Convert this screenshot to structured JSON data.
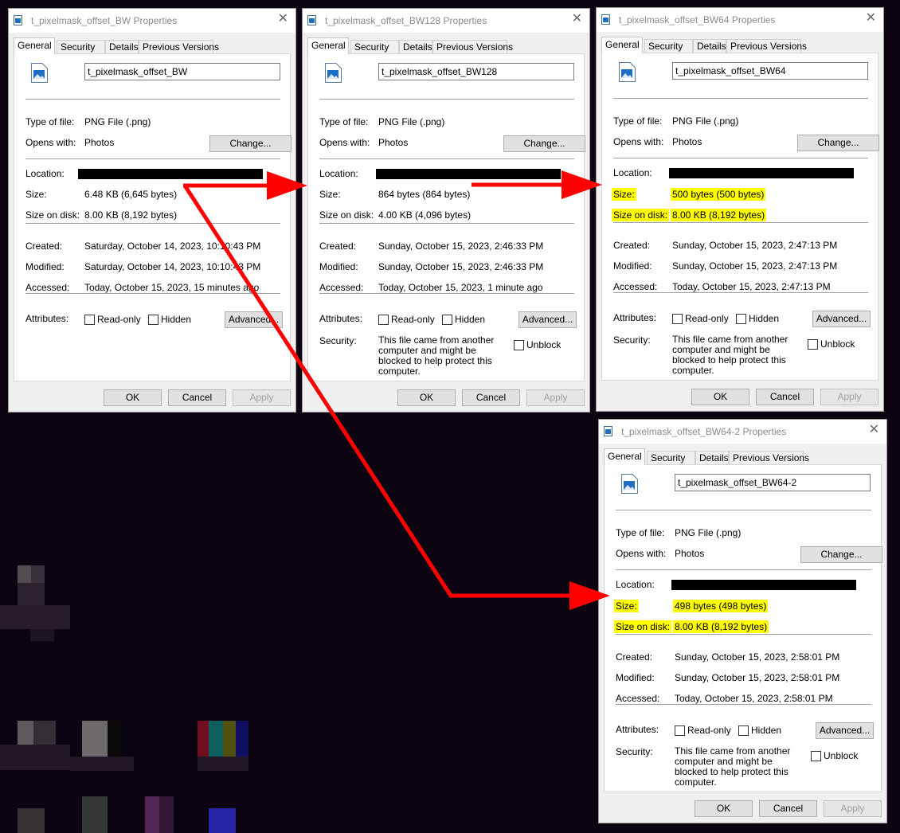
{
  "colors": {
    "background": "#0c0410",
    "highlight": "#ffff00",
    "arrow": "#ff0000"
  },
  "tabs": [
    "General",
    "Security",
    "Details",
    "Previous Versions"
  ],
  "labels": {
    "type_of_file": "Type of file:",
    "opens_with": "Opens with:",
    "change_button": "Change...",
    "location": "Location:",
    "size": "Size:",
    "size_on_disk": "Size on disk:",
    "created": "Created:",
    "modified": "Modified:",
    "accessed": "Accessed:",
    "attributes": "Attributes:",
    "read_only": "Read-only",
    "hidden": "Hidden",
    "advanced_button": "Advanced...",
    "security": "Security:",
    "security_text": "This file came from another computer and might be blocked to help protect this computer.",
    "unblock": "Unblock",
    "ok_button": "OK",
    "cancel_button": "Cancel",
    "apply_button": "Apply",
    "close_icon": "✕"
  },
  "dialogs": [
    {
      "title": "t_pixelmask_offset_BW Properties",
      "filename": "t_pixelmask_offset_BW",
      "type_of_file": "PNG File (.png)",
      "opens_with": "Photos",
      "size": "6.48 KB (6,645 bytes)",
      "size_on_disk": "8.00 KB (8,192 bytes)",
      "created": "Saturday, October 14, 2023, 10:10:43 PM",
      "modified": "Saturday, October 14, 2023, 10:10:43 PM",
      "accessed": "Today, October 15, 2023, 15 minutes ago"
    },
    {
      "title": "t_pixelmask_offset_BW128 Properties",
      "filename": "t_pixelmask_offset_BW128",
      "type_of_file": "PNG File (.png)",
      "opens_with": "Photos",
      "size": "864 bytes (864 bytes)",
      "size_on_disk": "4.00 KB (4,096 bytes)",
      "created": "Sunday, October 15, 2023, 2:46:33 PM",
      "modified": "Sunday, October 15, 2023, 2:46:33 PM",
      "accessed": "Today, October 15, 2023, 1 minute ago"
    },
    {
      "title": "t_pixelmask_offset_BW64 Properties",
      "filename": "t_pixelmask_offset_BW64",
      "type_of_file": "PNG File (.png)",
      "opens_with": "Photos",
      "size": "500 bytes (500 bytes)",
      "size_on_disk": "8.00 KB (8,192 bytes)",
      "created": "Sunday, October 15, 2023, 2:47:13 PM",
      "modified": "Sunday, October 15, 2023, 2:47:13 PM",
      "accessed": "Today, October 15, 2023, 2:47:13 PM"
    },
    {
      "title": "t_pixelmask_offset_BW64-2 Properties",
      "filename": "t_pixelmask_offset_BW64-2",
      "type_of_file": "PNG File (.png)",
      "opens_with": "Photos",
      "size": "498 bytes (498 bytes)",
      "size_on_disk": "8.00 KB (8,192 bytes)",
      "created": "Sunday, October 15, 2023, 2:58:01 PM",
      "modified": "Sunday, October 15, 2023, 2:58:01 PM",
      "accessed": "Today, October 15, 2023, 2:58:01 PM"
    }
  ]
}
